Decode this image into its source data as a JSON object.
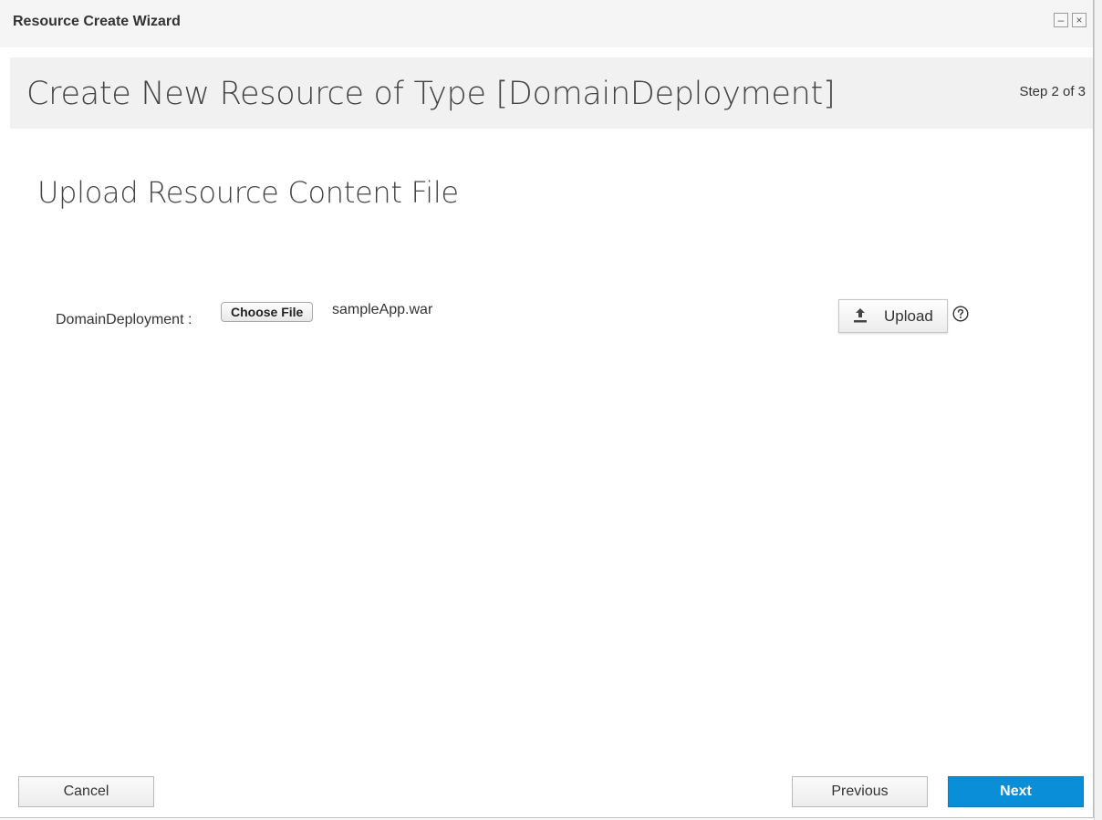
{
  "window": {
    "title": "Resource Create Wizard",
    "minimize_label": "–",
    "close_label": "×"
  },
  "header": {
    "title": "Create New Resource of Type [DomainDeployment]",
    "step": "Step 2 of 3"
  },
  "section": {
    "title": "Upload Resource Content File"
  },
  "upload_form": {
    "field_label": "DomainDeployment :",
    "choose_file_label": "Choose File",
    "file_name": "sampleApp.war",
    "upload_label": "Upload"
  },
  "footer": {
    "cancel_label": "Cancel",
    "previous_label": "Previous",
    "next_label": "Next"
  },
  "colors": {
    "primary": "#0a8ed8",
    "header_band": "#f1f1f1"
  },
  "icons": {
    "upload": "upload-icon",
    "help": "question-circle-icon"
  }
}
